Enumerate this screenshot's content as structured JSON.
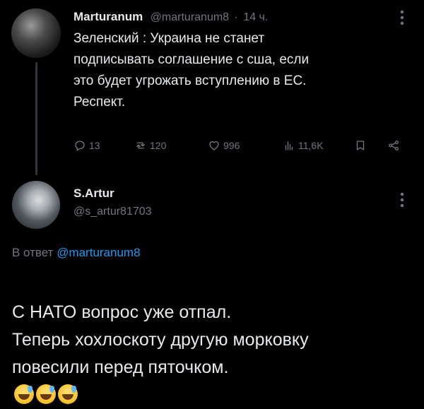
{
  "tweet1": {
    "author_name": "Marturanum",
    "handle": "@marturanum8",
    "separator": "·",
    "time": "14 ч.",
    "text": "Зеленский : Украина не станет\nподписывать соглашение с сша, если\nэто будет угрожать вступлению в ЕС.\nРеспект.",
    "replies": "13",
    "retweets": "120",
    "likes": "996",
    "views": "11,6K"
  },
  "tweet2": {
    "author_name": "S.Artur",
    "handle": "@s_artur81703",
    "reply_prefix": "В ответ",
    "reply_to": "@marturanum8",
    "text": "С НАТО вопрос уже отпал.\nТеперь хохлоскоту другую морковку\nповесили перед пяточком."
  },
  "icons": {
    "reply": "reply-icon",
    "retweet": "retweet-icon",
    "like": "heart-icon",
    "views": "views-icon",
    "bookmark": "bookmark-icon",
    "share": "share-icon",
    "more": "more-icon",
    "emoji": "sweat-smile-emoji"
  },
  "colors": {
    "background": "#000000",
    "text": "#e7e9ea",
    "muted": "#71767b",
    "link": "#1d9bf0"
  }
}
